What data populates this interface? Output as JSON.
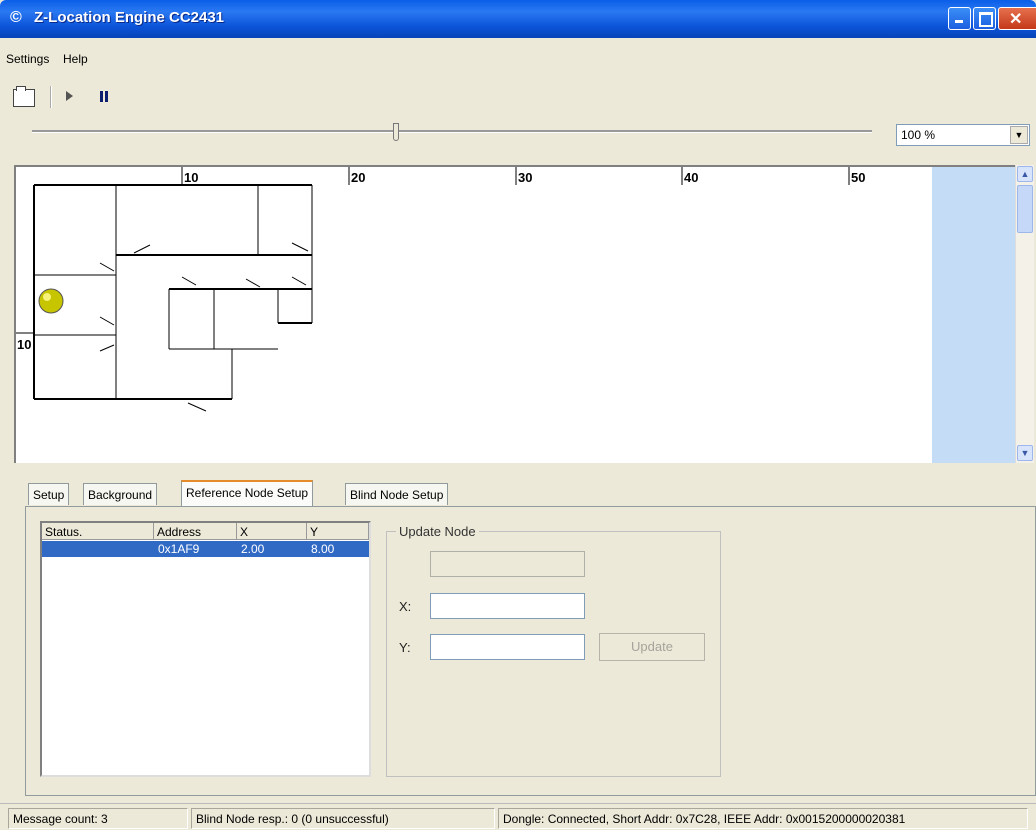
{
  "window": {
    "title": "Z-Location Engine CC2431"
  },
  "menu": {
    "items": [
      "Settings",
      "Help"
    ]
  },
  "toolbar": {
    "icons": [
      "open-icon",
      "play-icon",
      "pause-icon"
    ]
  },
  "zoom": {
    "value": "100 %",
    "slider_position": 0.44
  },
  "map": {
    "ruler_top": [
      "10",
      "20",
      "30",
      "40",
      "50"
    ],
    "ruler_left": [
      "10"
    ],
    "marker_color": "#c7c400"
  },
  "tabs": [
    {
      "label": "Setup",
      "active": false
    },
    {
      "label": "Background",
      "active": false
    },
    {
      "label": "Reference Node Setup",
      "active": true
    },
    {
      "label": "Blind Node Setup",
      "active": false
    }
  ],
  "node_table": {
    "columns": [
      "Status.",
      "Address",
      "X",
      "Y"
    ],
    "rows": [
      {
        "status": "",
        "address": "0x1AF9",
        "x": "2.00",
        "y": "8.00",
        "selected": true
      }
    ]
  },
  "update_node": {
    "group_label": "Update Node",
    "name_value": "",
    "x_label": "X:",
    "x_value": "",
    "y_label": "Y:",
    "y_value": "",
    "button_label": "Update"
  },
  "status": {
    "message_count": "Message count: 3",
    "blind_node": "Blind Node resp.: 0 (0 unsuccessful)",
    "dongle": "Dongle: Connected, Short Addr: 0x7C28, IEEE Addr: 0x0015200000020381"
  }
}
